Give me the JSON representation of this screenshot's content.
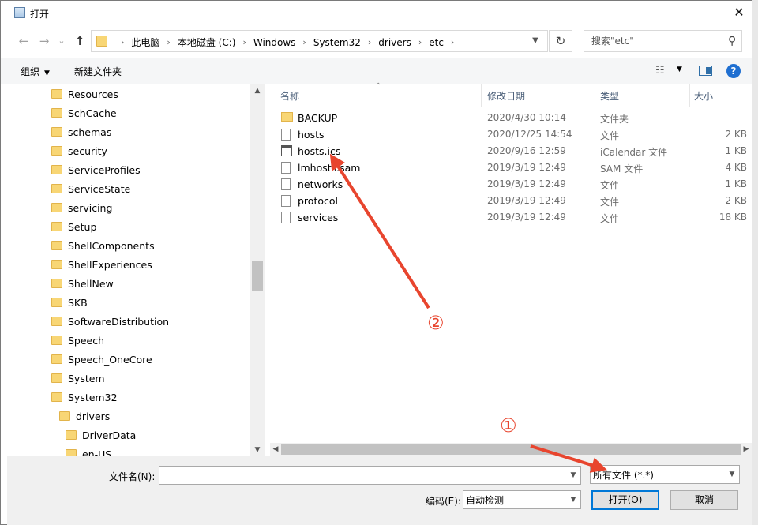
{
  "window": {
    "title": "打开",
    "close_glyph": "✕",
    "icon": "dialog-icon"
  },
  "nav": {
    "back_glyph": "←",
    "forward_glyph": "→",
    "recent_glyph": "⌄",
    "up_glyph": "↑",
    "breadcrumb": [
      "此电脑",
      "本地磁盘 (C:)",
      "Windows",
      "System32",
      "drivers",
      "etc"
    ],
    "refresh_glyph": "↻",
    "search_placeholder": "搜索\"etc\"",
    "search_glyph": "⚲"
  },
  "toolbar": {
    "organize_label": "组织",
    "new_folder_label": "新建文件夹",
    "help_glyph": "?"
  },
  "tree": {
    "items": [
      {
        "label": "Resources",
        "indent": 0
      },
      {
        "label": "SchCache",
        "indent": 0
      },
      {
        "label": "schemas",
        "indent": 0
      },
      {
        "label": "security",
        "indent": 0
      },
      {
        "label": "ServiceProfiles",
        "indent": 0
      },
      {
        "label": "ServiceState",
        "indent": 0
      },
      {
        "label": "servicing",
        "indent": 0
      },
      {
        "label": "Setup",
        "indent": 0
      },
      {
        "label": "ShellComponents",
        "indent": 0
      },
      {
        "label": "ShellExperiences",
        "indent": 0
      },
      {
        "label": "ShellNew",
        "indent": 0
      },
      {
        "label": "SKB",
        "indent": 0
      },
      {
        "label": "SoftwareDistribution",
        "indent": 0
      },
      {
        "label": "Speech",
        "indent": 0
      },
      {
        "label": "Speech_OneCore",
        "indent": 0
      },
      {
        "label": "System",
        "indent": 0
      },
      {
        "label": "System32",
        "indent": 0
      },
      {
        "label": "drivers",
        "indent": 1
      },
      {
        "label": "DriverData",
        "indent": 2
      },
      {
        "label": "en-US",
        "indent": 2
      }
    ]
  },
  "columns": {
    "name": "名称",
    "date": "修改日期",
    "type": "类型",
    "size": "大小"
  },
  "files": [
    {
      "name": "BACKUP",
      "date": "2020/4/30 10:14",
      "type": "文件夹",
      "size": "",
      "icon": "folder-icon"
    },
    {
      "name": "hosts",
      "date": "2020/12/25 14:54",
      "type": "文件",
      "size": "2 KB",
      "icon": "file-icon"
    },
    {
      "name": "hosts.ics",
      "date": "2020/9/16 12:59",
      "type": "iCalendar 文件",
      "size": "1 KB",
      "icon": "calendar-file-icon"
    },
    {
      "name": "lmhosts.sam",
      "date": "2019/3/19 12:49",
      "type": "SAM 文件",
      "size": "4 KB",
      "icon": "file-icon"
    },
    {
      "name": "networks",
      "date": "2019/3/19 12:49",
      "type": "文件",
      "size": "1 KB",
      "icon": "file-icon"
    },
    {
      "name": "protocol",
      "date": "2019/3/19 12:49",
      "type": "文件",
      "size": "2 KB",
      "icon": "file-icon"
    },
    {
      "name": "services",
      "date": "2019/3/19 12:49",
      "type": "文件",
      "size": "18 KB",
      "icon": "file-icon"
    }
  ],
  "bottom": {
    "filename_label": "文件名(N):",
    "filename_value": "",
    "filter_value": "所有文件 (*.*)",
    "encoding_label": "编码(E):",
    "encoding_value": "自动检测",
    "open_label": "打开(O)",
    "cancel_label": "取消"
  },
  "annotations": {
    "marker1": "①",
    "marker2": "②",
    "color": "#e8452e"
  }
}
